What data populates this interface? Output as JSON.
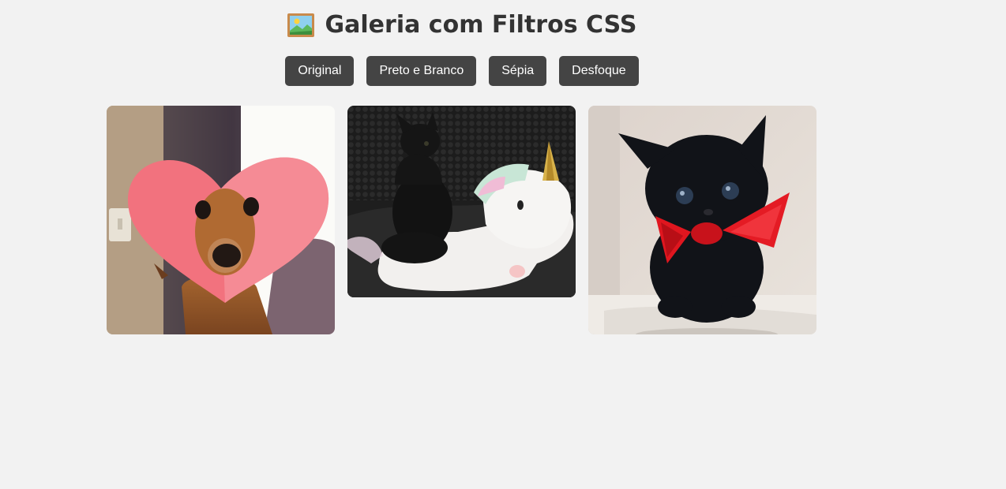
{
  "page": {
    "title": "Galeria com Filtros CSS",
    "title_icon": "framed-picture-icon"
  },
  "filters": [
    {
      "label": "Original"
    },
    {
      "label": "Preto e Branco"
    },
    {
      "label": "Sépia"
    },
    {
      "label": "Desfoque"
    }
  ],
  "gallery": {
    "images": [
      {
        "subject": "dog-with-paper-heart"
      },
      {
        "subject": "black-kitten-on-unicorn-plush"
      },
      {
        "subject": "black-kitten-with-red-bow"
      }
    ]
  },
  "colors": {
    "background": "#f2f2f2",
    "button_bg": "#444444",
    "button_text": "#ffffff",
    "title_text": "#333333"
  }
}
